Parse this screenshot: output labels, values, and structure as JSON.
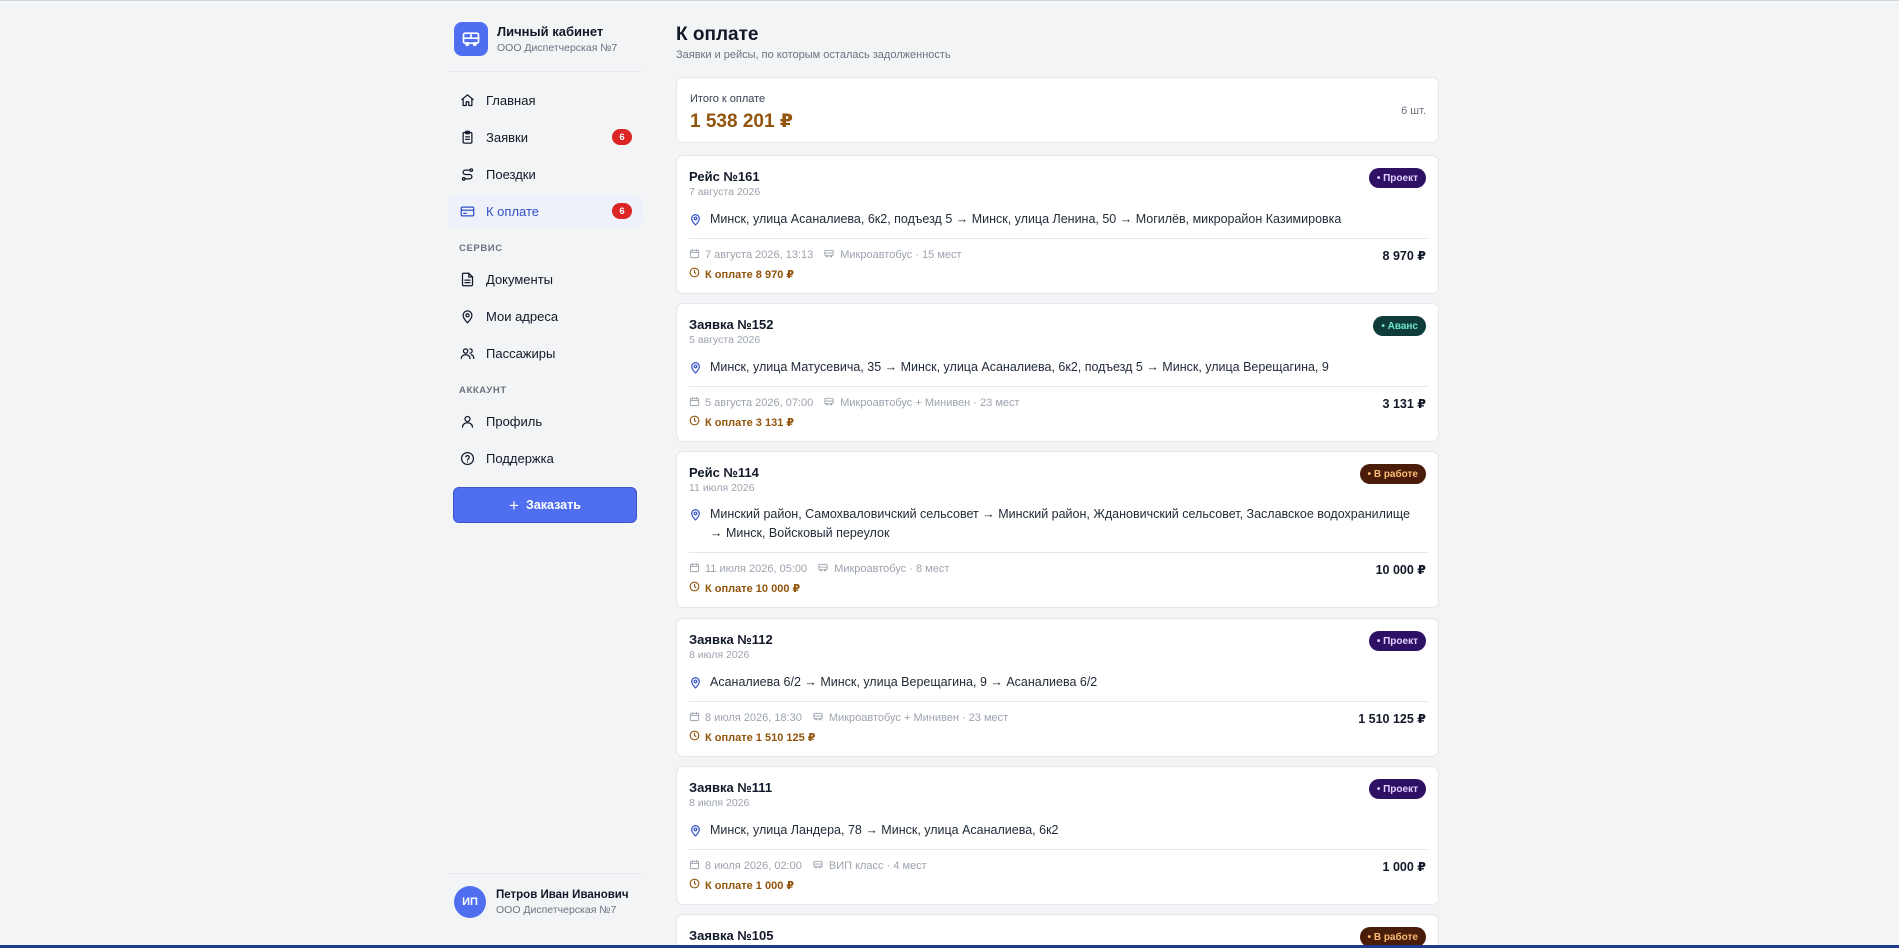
{
  "brand": {
    "title": "Личный кабинет",
    "subtitle": "ООО Диспетчерская №7"
  },
  "nav": {
    "main": [
      {
        "label": "Главная",
        "icon": "home-icon"
      },
      {
        "label": "Заявки",
        "icon": "clipboard-icon",
        "badge": "6"
      },
      {
        "label": "Поездки",
        "icon": "route-icon"
      },
      {
        "label": "К оплате",
        "icon": "card-icon",
        "badge": "6",
        "active": true
      }
    ],
    "service_label": "СЕРВИС",
    "service": [
      {
        "label": "Документы",
        "icon": "document-icon"
      },
      {
        "label": "Мои адреса",
        "icon": "pin-icon"
      },
      {
        "label": "Пассажиры",
        "icon": "users-icon"
      }
    ],
    "account_label": "АККАУНТ",
    "account": [
      {
        "label": "Профиль",
        "icon": "user-icon"
      },
      {
        "label": "Поддержка",
        "icon": "help-icon"
      }
    ],
    "order_button": "Заказать"
  },
  "user": {
    "initials": "ИП",
    "name": "Петров Иван Иванович",
    "org": "ООО Диспетчерская №7"
  },
  "page": {
    "title": "К оплате",
    "subtitle": "Заявки и рейсы, по которым осталась задолженность"
  },
  "total": {
    "label": "Итого к оплате",
    "value": "1 538 201 ₽",
    "count": "6 шт."
  },
  "cards": [
    {
      "title": "Рейс №161",
      "date": "7 августа 2026",
      "status": "• Проект",
      "route": "Минск, улица Асаналиева, 6к2, подъезд 5 → Минск, улица Ленина, 50 → Могилёв, микрорайон Казимировка",
      "datetime": "7 августа 2026, 13:13",
      "vehicle": "Микроавтобус · 15 мест",
      "price": "8 970 ₽",
      "due": "К оплате 8 970 ₽"
    },
    {
      "title": "Заявка №152",
      "date": "5 августа 2026",
      "status": "• Аванс",
      "route": "Минск, улица Матусевича, 35 → Минск, улица Асаналиева, 6к2, подъезд 5 → Минск, улица Верещагина, 9",
      "datetime": "5 августа 2026, 07:00",
      "vehicle": "Микроавтобус + Минивен · 23 мест",
      "price": "3 131 ₽",
      "due": "К оплате 3 131 ₽"
    },
    {
      "title": "Рейс №114",
      "date": "11 июля 2026",
      "status": "• В работе",
      "route": "Минский район, Самохваловичский сельсовет → Минский район, Ждановичский сельсовет, Заславское водохранилище → Минск, Войсковый переулок",
      "datetime": "11 июля 2026, 05:00",
      "vehicle": "Микроавтобус · 8 мест",
      "price": "10 000 ₽",
      "due": "К оплате 10 000 ₽"
    },
    {
      "title": "Заявка №112",
      "date": "8 июля 2026",
      "status": "• Проект",
      "route": "Асаналиева 6/2 → Минск, улица Верещагина, 9 → Асаналиева 6/2",
      "datetime": "8 июля 2026, 18:30",
      "vehicle": "Микроавтобус + Минивен · 23 мест",
      "price": "1 510 125 ₽",
      "due": "К оплате 1 510 125 ₽"
    },
    {
      "title": "Заявка №111",
      "date": "8 июля 2026",
      "status": "• Проект",
      "route": "Минск, улица Ландера, 78 → Минск, улица Асаналиева, 6к2",
      "datetime": "8 июля 2026, 02:00",
      "vehicle": "ВИП класс · 4 мест",
      "price": "1 000 ₽",
      "due": "К оплате 1 000 ₽"
    },
    {
      "title": "Заявка №105",
      "status": "• В работе"
    }
  ],
  "colors": {
    "accent": "#4f6ef0",
    "badge": "#dc2626",
    "due": "#92540b",
    "project": "#2e1065",
    "advance": "#0f3b3a",
    "work": "#4a1d0b"
  }
}
